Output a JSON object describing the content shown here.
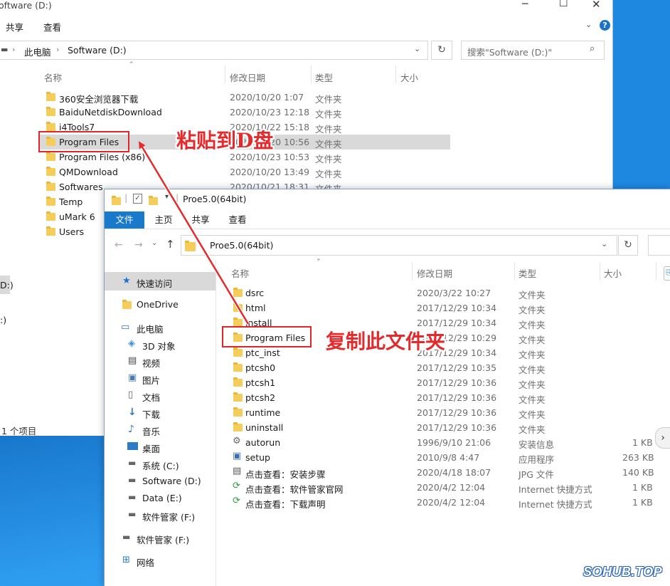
{
  "back_window": {
    "title": "oftware (D:)",
    "ribbon_tabs": [
      "共享",
      "查看"
    ],
    "breadcrumb": [
      "此电脑",
      "Software (D:)"
    ],
    "search_placeholder": "搜索\"Software (D:)\"",
    "columns": {
      "name": "名称",
      "date": "修改日期",
      "type": "类型",
      "size": "大小"
    },
    "rows": [
      {
        "name": "360安全浏览器下载",
        "date": "2020/10/20 1:07",
        "type": "文件夹"
      },
      {
        "name": "BaiduNetdiskDownload",
        "date": "2020/10/23 12:18",
        "type": "文件夹"
      },
      {
        "name": "i4Tools7",
        "date": "2020/10/22 15:18",
        "type": "文件夹"
      },
      {
        "name": "Program Files",
        "date": "2020/10/20 10:56",
        "type": "文件夹"
      },
      {
        "name": "Program Files (x86)",
        "date": "2020/10/23 10:53",
        "type": "文件夹"
      },
      {
        "name": "QMDownload",
        "date": "2020/10/20 13:49",
        "type": "文件夹"
      },
      {
        "name": "Softwares",
        "date": "2020/10/21 18:31",
        "type": "文件夹"
      },
      {
        "name": "Temp",
        "date": "",
        "type": ""
      },
      {
        "name": "uMark 6",
        "date": "",
        "type": ""
      },
      {
        "name": "Users",
        "date": "",
        "type": ""
      }
    ],
    "sidebar_fragments": [
      "D:)",
      ":)"
    ],
    "status": "1 个项目"
  },
  "front_window": {
    "title": "Proe5.0(64bit)",
    "ribbon_tabs": [
      "文件",
      "主页",
      "共享",
      "查看"
    ],
    "address": "Proe5.0(64bit)",
    "columns": {
      "name": "名称",
      "date": "修改日期",
      "type": "类型",
      "size": "大小"
    },
    "sidebar": [
      {
        "label": "快速访问",
        "icon": "star-icon"
      },
      {
        "label": "OneDrive",
        "icon": "folder-icon"
      },
      {
        "label": "此电脑",
        "icon": "computer-icon"
      },
      {
        "label": "3D 对象",
        "icon": "cube-icon"
      },
      {
        "label": "视频",
        "icon": "video-icon"
      },
      {
        "label": "图片",
        "icon": "picture-icon"
      },
      {
        "label": "文档",
        "icon": "document-icon"
      },
      {
        "label": "下载",
        "icon": "download-icon"
      },
      {
        "label": "音乐",
        "icon": "music-icon"
      },
      {
        "label": "桌面",
        "icon": "desktop-icon"
      },
      {
        "label": "系统 (C:)",
        "icon": "drive-icon"
      },
      {
        "label": "Software (D:)",
        "icon": "drive-icon"
      },
      {
        "label": "Data (E:)",
        "icon": "drive-icon"
      },
      {
        "label": "软件管家 (F:)",
        "icon": "drive-icon"
      },
      {
        "label": "软件管家 (F:)",
        "icon": "drive-icon"
      },
      {
        "label": "网络",
        "icon": "network-icon"
      }
    ],
    "rows": [
      {
        "name": "dsrc",
        "date": "2020/3/22 10:27",
        "type": "文件夹",
        "size": "",
        "icon": "folder"
      },
      {
        "name": "html",
        "date": "2017/12/29 10:34",
        "type": "文件夹",
        "size": "",
        "icon": "folder"
      },
      {
        "name": "install",
        "date": "2017/12/29 10:34",
        "type": "文件夹",
        "size": "",
        "icon": "folder"
      },
      {
        "name": "Program Files",
        "date": "2017/12/29 10:29",
        "type": "文件夹",
        "size": "",
        "icon": "folder"
      },
      {
        "name": "ptc_inst",
        "date": "2017/12/29 10:34",
        "type": "文件夹",
        "size": "",
        "icon": "folder"
      },
      {
        "name": "ptcsh0",
        "date": "2017/12/29 10:35",
        "type": "文件夹",
        "size": "",
        "icon": "folder"
      },
      {
        "name": "ptcsh1",
        "date": "2017/12/29 10:36",
        "type": "文件夹",
        "size": "",
        "icon": "folder"
      },
      {
        "name": "ptcsh2",
        "date": "2017/12/29 10:36",
        "type": "文件夹",
        "size": "",
        "icon": "folder"
      },
      {
        "name": "runtime",
        "date": "2017/12/29 10:36",
        "type": "文件夹",
        "size": "",
        "icon": "folder"
      },
      {
        "name": "uninstall",
        "date": "2017/12/29 10:36",
        "type": "文件夹",
        "size": "",
        "icon": "folder"
      },
      {
        "name": "autorun",
        "date": "1996/9/10 21:06",
        "type": "安装信息",
        "size": "1 KB",
        "icon": "setup-info"
      },
      {
        "name": "setup",
        "date": "2010/9/8 4:47",
        "type": "应用程序",
        "size": "263 KB",
        "icon": "app"
      },
      {
        "name": "点击查看：安装步骤",
        "date": "2020/4/18 18:07",
        "type": "JPG 文件",
        "size": "140 KB",
        "icon": "jpg"
      },
      {
        "name": "点击查看：软件管家官网",
        "date": "2020/4/2 12:04",
        "type": "Internet 快捷方式",
        "size": "1 KB",
        "icon": "link"
      },
      {
        "name": "点击查看：下载声明",
        "date": "2020/4/2 12:04",
        "type": "Internet 快捷方式",
        "size": "1 KB",
        "icon": "link"
      }
    ]
  },
  "annotations": {
    "paste": "粘贴到D盘",
    "copy": "复制此文件夹",
    "color": "#e32b2d"
  },
  "watermark": "SOHUB.TOP"
}
